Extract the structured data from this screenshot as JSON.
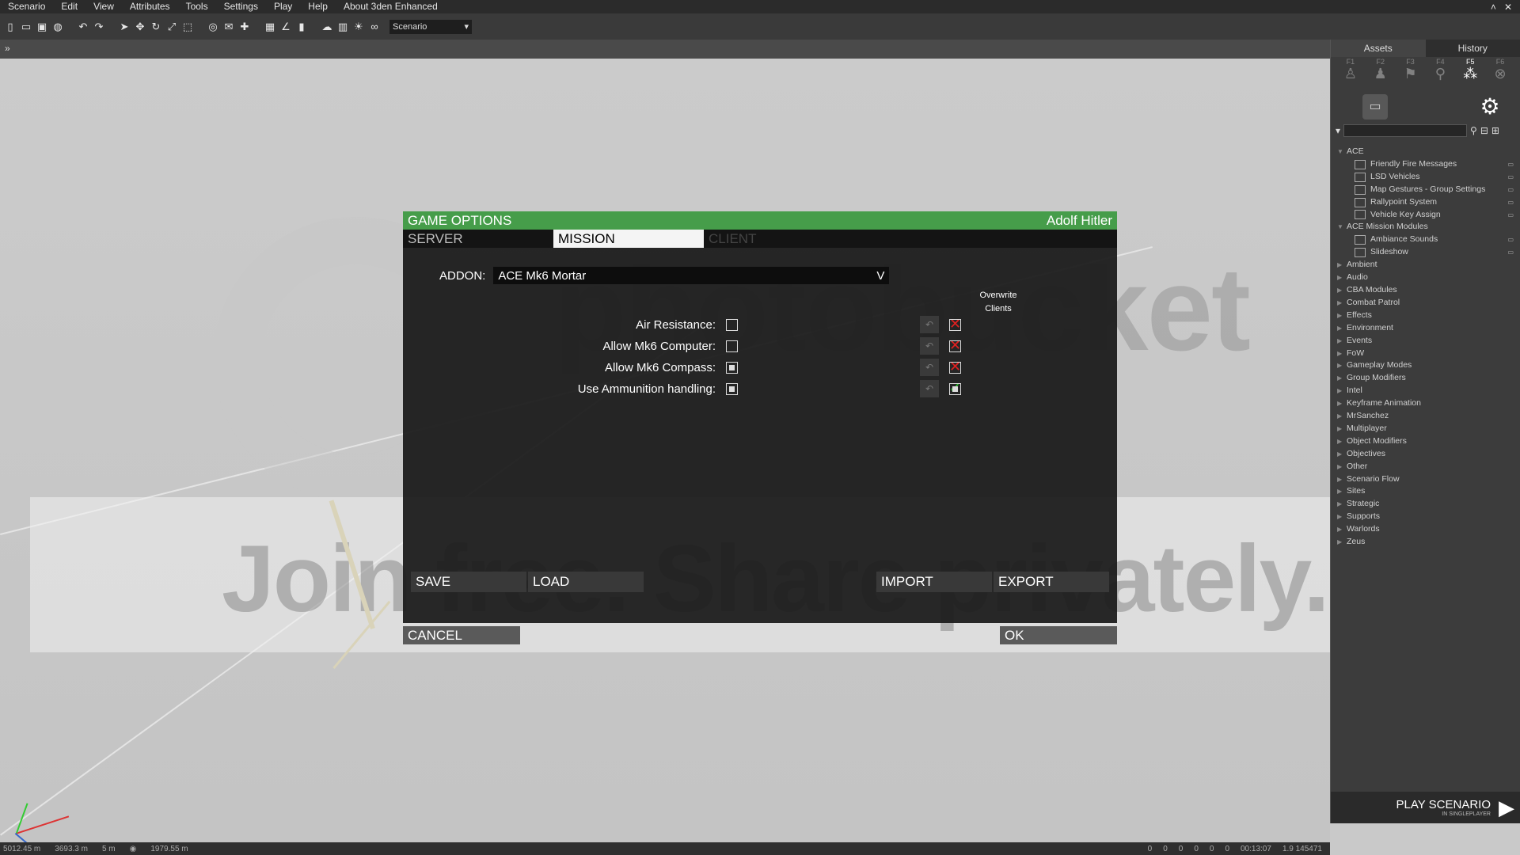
{
  "menubar": {
    "items": [
      "Scenario",
      "Edit",
      "View",
      "Attributes",
      "Tools",
      "Settings",
      "Play",
      "Help",
      "About 3den Enhanced"
    ]
  },
  "toolbar": {
    "scenario_combo": "Scenario"
  },
  "right_panel": {
    "tabs": [
      "Assets",
      "History"
    ],
    "function_keys": [
      "F1",
      "F2",
      "F3",
      "F4",
      "F5",
      "F6"
    ],
    "active_function_key": "F5",
    "search_placeholder": "",
    "tree": [
      {
        "label": "ACE",
        "expanded": true,
        "children": [
          "Friendly Fire Messages",
          "LSD Vehicles",
          "Map Gestures - Group Settings",
          "Rallypoint System",
          "Vehicle Key Assign"
        ]
      },
      {
        "label": "ACE Mission Modules",
        "expanded": true,
        "children": [
          "Ambiance Sounds",
          "Slideshow"
        ]
      },
      {
        "label": "Ambient"
      },
      {
        "label": "Audio"
      },
      {
        "label": "CBA Modules"
      },
      {
        "label": "Combat Patrol"
      },
      {
        "label": "Effects"
      },
      {
        "label": "Environment"
      },
      {
        "label": "Events"
      },
      {
        "label": "FoW"
      },
      {
        "label": "Gameplay Modes"
      },
      {
        "label": "Group Modifiers"
      },
      {
        "label": "Intel"
      },
      {
        "label": "Keyframe Animation"
      },
      {
        "label": "MrSanchez"
      },
      {
        "label": "Multiplayer"
      },
      {
        "label": "Object Modifiers"
      },
      {
        "label": "Objectives"
      },
      {
        "label": "Other"
      },
      {
        "label": "Scenario Flow"
      },
      {
        "label": "Sites"
      },
      {
        "label": "Strategic"
      },
      {
        "label": "Supports"
      },
      {
        "label": "Warlords"
      },
      {
        "label": "Zeus"
      }
    ],
    "play_button": "PLAY SCENARIO",
    "play_sub": "IN SINGLEPLAYER"
  },
  "statusbar": {
    "x": "5012.45 m",
    "y": "3693.3 m",
    "z": "5 m",
    "dist": "1979.55 m",
    "counts": [
      "0",
      "0",
      "0",
      "0",
      "0",
      "0"
    ],
    "time": "00:13:07",
    "version": "1.9 145471"
  },
  "watermark": {
    "brand": "photobucket",
    "tagline": "Join free. Share privately."
  },
  "dialog": {
    "title": "GAME OPTIONS",
    "user": "Adolf Hitler",
    "tabs": [
      "SERVER",
      "MISSION",
      "CLIENT"
    ],
    "active_tab": "MISSION",
    "addon_label": "ADDON:",
    "addon_value": "ACE Mk6 Mortar",
    "overwrite_header": "Overwrite Clients",
    "options": [
      {
        "label": "Air Resistance:",
        "checked": false,
        "status": "x",
        "overwrite": false
      },
      {
        "label": "Allow Mk6 Computer:",
        "checked": false,
        "status": "x",
        "overwrite": false
      },
      {
        "label": "Allow Mk6 Compass:",
        "checked": true,
        "status": "x",
        "overwrite": false
      },
      {
        "label": "Use Ammunition handling:",
        "checked": true,
        "status": "ok",
        "overwrite": true
      }
    ],
    "buttons": {
      "save": "SAVE",
      "load": "LOAD",
      "import": "IMPORT",
      "export": "EXPORT",
      "cancel": "CANCEL",
      "ok": "OK"
    }
  }
}
